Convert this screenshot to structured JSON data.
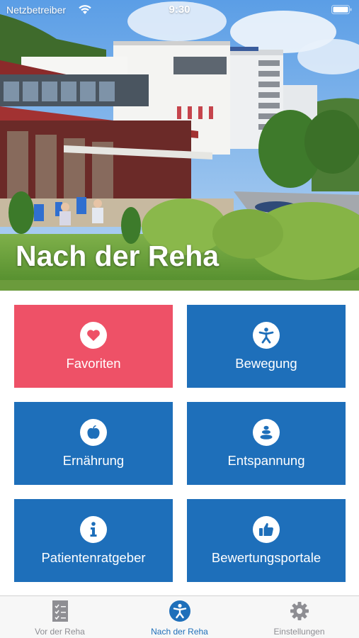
{
  "status_bar": {
    "carrier": "Netzbetreiber",
    "time": "9:30",
    "wifi_icon": "wifi-icon",
    "battery_icon": "battery-icon"
  },
  "hero": {
    "title": "Nach der Reha",
    "image": "clinic-building-photo"
  },
  "tiles": [
    {
      "label": "Favoriten",
      "icon": "heart-icon",
      "color": "#ee5167"
    },
    {
      "label": "Bewegung",
      "icon": "person-exercise-icon",
      "color": "#1e6fba"
    },
    {
      "label": "Ernährung",
      "icon": "apple-icon",
      "color": "#1e6fba"
    },
    {
      "label": "Entspannung",
      "icon": "stones-icon",
      "color": "#1e6fba"
    },
    {
      "label": "Patientenratgeber",
      "icon": "info-icon",
      "color": "#1e6fba"
    },
    {
      "label": "Bewertungsportale",
      "icon": "thumbs-up-icon",
      "color": "#1e6fba"
    }
  ],
  "tab_bar": {
    "items": [
      {
        "label": "Vor der Reha",
        "icon": "checklist-icon",
        "active": false
      },
      {
        "label": "Nach der Reha",
        "icon": "person-circle-icon",
        "active": true
      },
      {
        "label": "Einstellungen",
        "icon": "gear-icon",
        "active": false
      }
    ],
    "active_color": "#1e6fba",
    "inactive_color": "#8e8e93"
  }
}
